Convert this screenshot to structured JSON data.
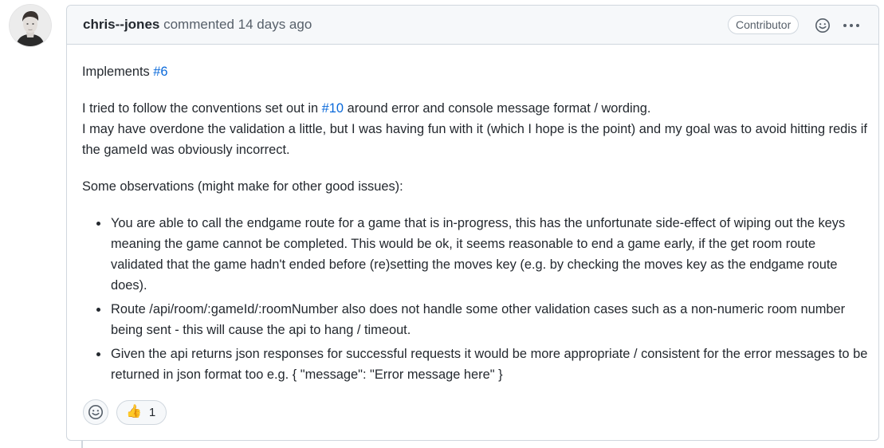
{
  "comment": {
    "author": "chris--jones",
    "action": "commented",
    "age": "14 days ago",
    "badge": "Contributor",
    "body": {
      "p1_prefix": "Implements ",
      "p1_link": "#6",
      "p2_prefix": "I tried to follow the conventions set out in ",
      "p2_link": "#10",
      "p2_suffix": " around error and console message format / wording.",
      "p3": "I may have overdone the validation a little, but I was having fun with it (which I hope is the point) and my goal was to avoid hitting redis if the gameId was obviously incorrect.",
      "p4": "Some observations (might make for other good issues):",
      "items": [
        "You are able to call the endgame route for a game that is in-progress, this has the unfortunate side-effect of wiping out the keys meaning the game cannot be completed. This would be ok, it seems reasonable to end a game early, if the get room route validated that the game hadn't ended before (re)setting the moves key (e.g. by checking the moves key as the endgame route does).",
        "Route /api/room/:gameId/:roomNumber also does not handle some other validation cases such as a non-numeric room number being sent - this will cause the api to hang / timeout.",
        "Given the api returns json responses for successful requests it would be more appropriate / consistent for the error messages to be returned in json format too e.g. { \"message\": \"Error message here\" }"
      ]
    },
    "reactions": [
      {
        "emoji": "👍",
        "icon": "thumbs-up-icon",
        "count": "1"
      }
    ]
  },
  "colors": {
    "link": "#0969da",
    "border": "#d0d7de",
    "header_bg": "#f6f8fa",
    "muted": "#57606a",
    "text": "#24292f"
  }
}
